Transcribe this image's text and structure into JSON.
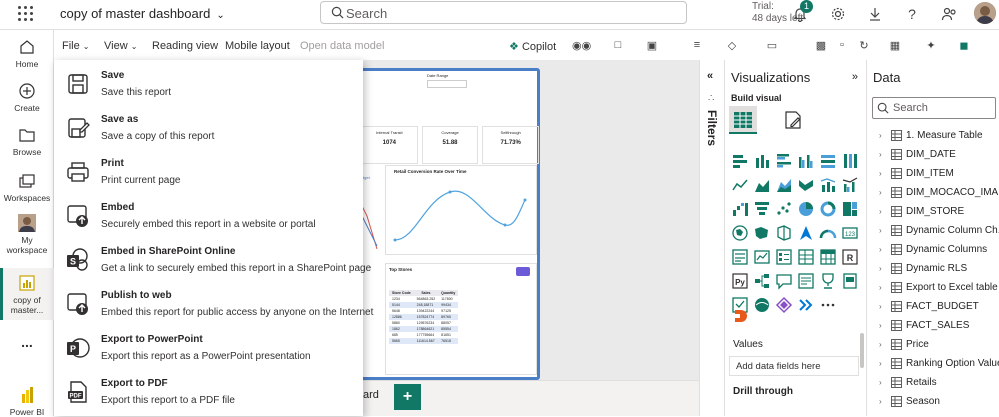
{
  "header": {
    "report_title": "copy of master dashboard",
    "search_placeholder": "Search",
    "trial_label": "Trial:",
    "trial_days": "48 days left",
    "notification_count": "1"
  },
  "nav": {
    "home": "Home",
    "create": "Create",
    "browse": "Browse",
    "workspaces": "Workspaces",
    "my_workspace_1": "My",
    "my_workspace_2": "workspace",
    "copy_1": "copy of",
    "copy_2": "master...",
    "more": "...",
    "powerbi": "Power BI"
  },
  "ribbon": {
    "file": "File",
    "view": "View",
    "reading_view": "Reading view",
    "mobile_layout": "Mobile layout",
    "open_data_model": "Open data model",
    "copilot": "Copilot"
  },
  "file_menu": [
    {
      "title": "Save",
      "desc": "Save this report",
      "icon": "save-icon"
    },
    {
      "title": "Save as",
      "desc": "Save a copy of this report",
      "icon": "save-as-icon"
    },
    {
      "title": "Print",
      "desc": "Print current page",
      "icon": "print-icon"
    },
    {
      "title": "Embed",
      "desc": "Securely embed this report in a website or portal",
      "icon": "embed-icon"
    },
    {
      "title": "Embed in SharePoint Online",
      "desc": "Get a link to securely embed this report in a SharePoint page",
      "icon": "sharepoint-icon"
    },
    {
      "title": "Publish to web",
      "desc": "Embed this report for public access by anyone on the Internet",
      "icon": "publish-icon"
    },
    {
      "title": "Export to PowerPoint",
      "desc": "Export this report as a PowerPoint presentation",
      "icon": "powerpoint-icon"
    },
    {
      "title": "Export to PDF",
      "desc": "Export this report to a PDF file",
      "icon": "pdf-icon"
    }
  ],
  "report_preview": {
    "date_range": "Date Range",
    "kpis": [
      {
        "label": "Internal Transit",
        "value": "1074"
      },
      {
        "label": "Coverage",
        "value": "51.88"
      },
      {
        "label": "Sellthrough",
        "value": "71.73%"
      }
    ],
    "legend_budget": "Budget",
    "chart_title": "Retail Conversion Rate Over Time",
    "top_stores_title": "Top Stores",
    "table_headers": [
      "Store Code",
      "Sales",
      "Quantity"
    ],
    "table_rows": [
      [
        "1234",
        "564863.252",
        "117800"
      ],
      [
        "5144",
        "248,18871",
        "99434"
      ],
      [
        "5648",
        "139422244",
        "97125"
      ],
      [
        "12886",
        "157824774",
        "89765"
      ],
      [
        "5880",
        "129576234",
        "88057"
      ],
      [
        "1862",
        "178864621",
        "85554"
      ],
      [
        "685",
        "177755664",
        "81651"
      ],
      [
        "5665",
        "111614.567",
        "76518"
      ]
    ]
  },
  "filters": {
    "label": "Filters"
  },
  "visualizations": {
    "title": "Visualizations",
    "build_visual": "Build visual",
    "values_label": "Values",
    "add_fields": "Add data fields here",
    "drill_through": "Drill through"
  },
  "data_pane": {
    "title": "Data",
    "search_placeholder": "Search",
    "tables": [
      "1. Measure Table",
      "DIM_DATE",
      "DIM_ITEM",
      "DIM_MOCACO_IMA...",
      "DIM_STORE",
      "Dynamic Column Ch...",
      "Dynamic Columns",
      "Dynamic RLS",
      "Export to Excel table",
      "FACT_BUDGET",
      "FACT_SALES",
      "Price",
      "Ranking Option Value",
      "Retails",
      "Season"
    ]
  },
  "tabs": {
    "partial_label": "ard",
    "add_label": "+"
  },
  "colors": {
    "accent": "#117865",
    "report_border": "#4a7ec7"
  }
}
